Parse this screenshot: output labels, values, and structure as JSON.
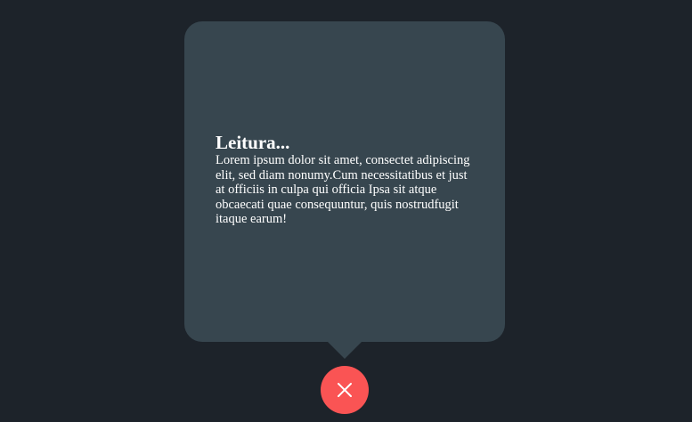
{
  "popup": {
    "title": "Leitura...",
    "text": "Lorem ipsum dolor sit amet, consectet adipiscing elit, sed diam nonumy.Cum necessitatibus et just at officiis in culpa qui officia Ipsa sit atque obcaecati quae consequuntur, quis nostrudfugit itaque earum!"
  },
  "close_button": {
    "icon": "close-icon"
  },
  "colors": {
    "background": "#1d232a",
    "popup": "#37464f",
    "accent": "#fa5454",
    "text": "#ffffff"
  }
}
